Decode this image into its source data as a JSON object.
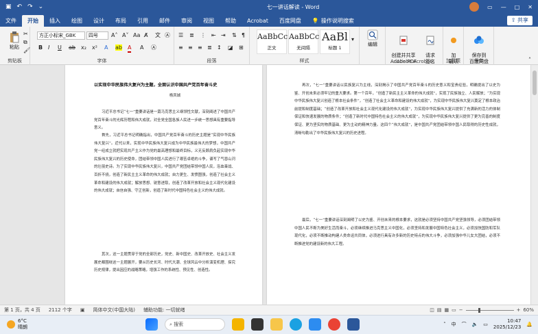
{
  "titlebar": {
    "doc_title": "七一讲话解读 - Word",
    "autosave": "",
    "user_avatar": "avatar"
  },
  "menu": {
    "tabs": [
      "文件",
      "开始",
      "插入",
      "绘图",
      "设计",
      "布局",
      "引用",
      "邮件",
      "审阅",
      "视图",
      "帮助",
      "Acrobat",
      "百度网盘"
    ],
    "active": "开始",
    "search_label": "操作说明搜索",
    "share_label": "共享"
  },
  "ribbon": {
    "clipboard": {
      "paste": "粘贴",
      "group": "剪贴板"
    },
    "font": {
      "name": "方正小标宋_GBK",
      "size": "四号",
      "group": "字体"
    },
    "paragraph": {
      "group": "段落"
    },
    "styles": {
      "group": "样式",
      "items": [
        {
          "sample": "AaBbCc",
          "name": "正文"
        },
        {
          "sample": "AaBbCc",
          "name": "无间隔"
        },
        {
          "sample": "AaBl",
          "name": "标题 1"
        }
      ]
    },
    "editing": {
      "label": "编辑"
    },
    "acrobat": {
      "create_share": "创建并共享\nAdobe PDF",
      "request_sign": "请求\n签名",
      "group": "Adobe Acrobat"
    },
    "addins": {
      "label": "加\n载项",
      "group": "加载项"
    },
    "save": {
      "label": "保存到\n百度网盘",
      "group": "保存"
    }
  },
  "page_left": {
    "title": "以实现中华民族伟大复兴为主题，全面认识中国共产党百年奋斗史",
    "author": "杨凤城",
    "paragraphs": [
      "习近平总书记“七一”重要讲话是一篇马克思主义纲领性文献，深刻阐述了中国共产党百年奋斗的光辉历程和伟大成就，对全党全国各族人民进一步统一思想具有重要指导意义。",
      "首先，习近平总书记明确指出，中国共产党百年奋斗的历史主题是“实现中华民族伟大复兴”。近代以来，实现中华民族伟大复兴成为中华民族最伟大的梦想，中国共产党一经成立就把实现共产主义作为党的最高理想和最终目标，义无反顾肩负起实现中华民族伟大复兴的历史使命，团结带领中国人民进行了艰苦卓绝的斗争，谱写了气吞山河的壮丽史诗。为了实现中华民族伟大复兴，中国共产党团结带领中国人民，浴血奋战、百折不挠，创造了新民主主义革命的伟大成就；自力更生、发愤图强，创造了社会主义革命和建设的伟大成就；解放思想、锐意进取，创造了改革开放和社会主义现代化建设的伟大成就；自信自强、守正创新，创造了新时代中国特色社会主义的伟大成就。",
      "其次，这一主题贯穿于党的全部历史，党史、新中国史、改革开放史、社会主义发展史都围绕这一主题展开，要从历史长河、时代大潮、全球风云中分析演变机理、探究历史规律，提出因应的战略策略，增强工作的系统性、预见性、创造性。"
    ]
  },
  "page_right": {
    "paragraphs": [
      "再次，“七一”重要讲话以民族复兴为主线，深刻揭示了中国共产党百年奋斗的历史意义和宝贵经验，明确提出了以史为鉴、开创未来必须牢记的重大要求。第一个百年，“创造了新民主主义革命的伟大成就”，实现了民族独立、人民解放；“为实现中华民族伟大复兴创造了根本社会条件”，“创造了社会主义革命和建设的伟大成就”，为实现中华民族伟大复兴奠定了根本政治前提和制度基础；“创造了改革开放和社会主义现代化建设的伟大成就”，为实现中华民族伟大复兴提供了充满新的活力的体制保证和快速发展的物质条件；“创造了新时代中国特色社会主义的伟大成就”，为实现中华民族伟大复兴提供了更为完善的制度保证、更为坚实的物质基础、更为主动的精神力量。这四个“伟大成就”，是中国共产党团结带领中国人民取得的历史性成就，清晰勾勒出了中华民族伟大复兴的历史进程。",
      "最后，“七一”重要讲话深刻阐明了以史为鉴、开创未来的根本要求，这就是必须坚持中国共产党坚强领导，必须团结带领中国人民不断为美好生活而奋斗，必须继续推进马克思主义中国化，必须坚持和发展中国特色社会主义，必须加快国防和军队现代化，必须不断推动构建人类命运共同体，必须进行具有许多新的历史特点的伟大斗争，必须加强中华儿女大团结，必须不断推进党的建设新的伟大工程。"
    ]
  },
  "status": {
    "page": "第 1 页，共 4 页",
    "words": "2112 个字",
    "lang": "简体中文(中国大陆)",
    "access": "辅助功能: 一切就绪",
    "zoom": "60%",
    "zoom_value": 60
  },
  "taskbar": {
    "weather_temp": "6°C",
    "weather_desc": "晴朗",
    "search": "搜索",
    "lang": "中",
    "time": "10:47",
    "date": "2025/12/23"
  },
  "colors": {
    "word_blue": "#2b579a"
  }
}
